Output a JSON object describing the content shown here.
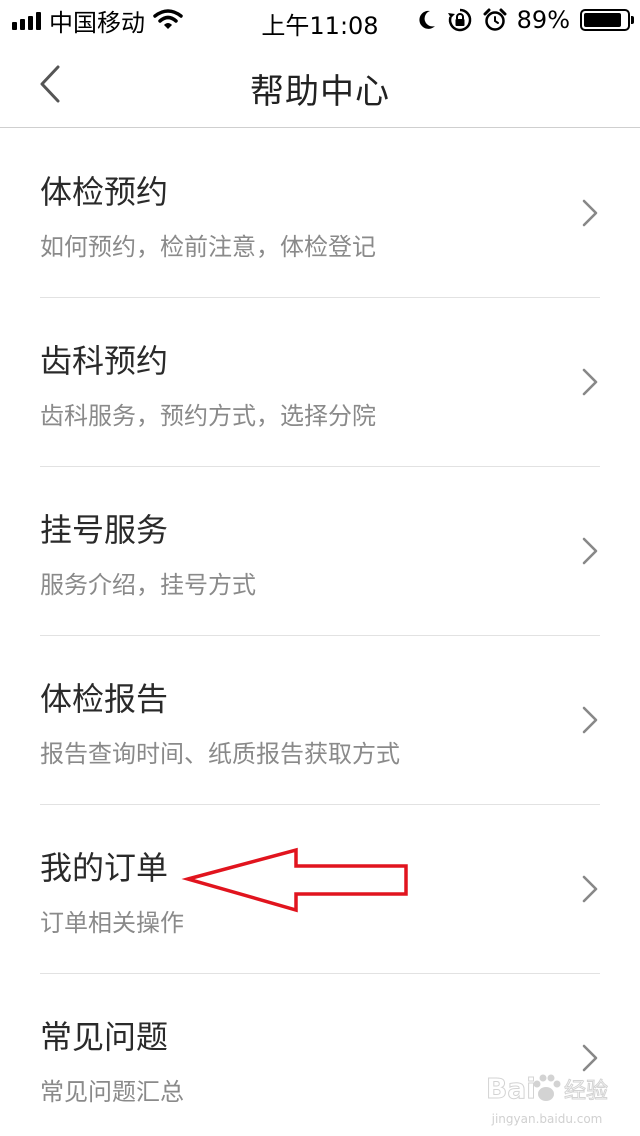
{
  "status_bar": {
    "carrier": "中国移动",
    "time": "上午11:08",
    "battery_percent": "89%",
    "battery_level": 0.89,
    "icons": [
      "signal-icon",
      "wifi-icon",
      "moon-icon",
      "rotation-lock-icon",
      "alarm-icon",
      "battery-icon"
    ]
  },
  "nav": {
    "title": "帮助中心",
    "back_icon": "chevron-left-icon"
  },
  "help_items": [
    {
      "title": "体检预约",
      "subtitle": "如何预约，检前注意，体检登记"
    },
    {
      "title": "齿科预约",
      "subtitle": "齿科服务，预约方式，选择分院"
    },
    {
      "title": "挂号服务",
      "subtitle": "服务介绍，挂号方式"
    },
    {
      "title": "体检报告",
      "subtitle": "报告查询时间、纸质报告获取方式"
    },
    {
      "title": "我的订单",
      "subtitle": "订单相关操作"
    },
    {
      "title": "常见问题",
      "subtitle": "常见问题汇总"
    }
  ],
  "annotation": {
    "color": "#e1141e",
    "target": "我的订单"
  },
  "watermark": {
    "text": "jingyan.baidu.com"
  }
}
